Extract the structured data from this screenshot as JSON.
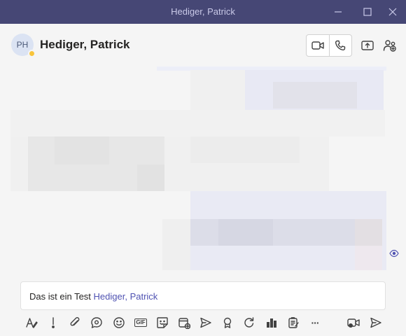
{
  "window": {
    "title": "Hediger, Patrick"
  },
  "header": {
    "avatar_initials": "PH",
    "contact_name": "Hediger, Patrick",
    "presence_color": "#f8c43a"
  },
  "composer": {
    "text": "Das ist ein Test ",
    "mention": "Hediger, Patrick"
  },
  "toolbar": {
    "gif_label": "GIF",
    "more_label": "···"
  },
  "colors": {
    "titlebar": "#464775",
    "accent": "#4f52b2",
    "background": "#f5f5f5"
  }
}
